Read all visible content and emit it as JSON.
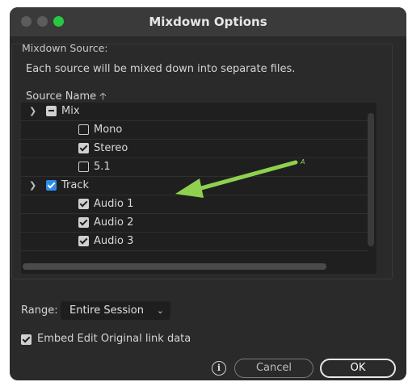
{
  "window": {
    "title": "Mixdown Options"
  },
  "mixdown_source": {
    "legend": "Mixdown Source:",
    "description": "Each source will be mixed down into separate files.",
    "column_header": "Source Name",
    "sort_icon": "sort-ascending-icon"
  },
  "tree": {
    "rows": [
      {
        "label": "Mix",
        "state": "mixed",
        "expandable": true
      },
      {
        "label": "Mono",
        "state": "unchecked"
      },
      {
        "label": "Stereo",
        "state": "checked"
      },
      {
        "label": "5.1",
        "state": "unchecked"
      },
      {
        "label": "Track",
        "state": "checked-blue",
        "expandable": true
      },
      {
        "label": "Audio 1",
        "state": "checked"
      },
      {
        "label": "Audio 2",
        "state": "checked"
      },
      {
        "label": "Audio 3",
        "state": "checked"
      }
    ]
  },
  "annotation": {
    "color": "#8fd14f",
    "label": "A"
  },
  "range": {
    "label": "Range:",
    "value": "Entire Session"
  },
  "embed": {
    "label": "Embed Edit Original link data",
    "checked": true
  },
  "buttons": {
    "cancel": "Cancel",
    "ok": "OK",
    "info": "i"
  },
  "colors": {
    "close": "#5c5c5c",
    "minimize": "#5c5c5c",
    "maximize": "#28c840",
    "accent": "#2d8ceb"
  }
}
